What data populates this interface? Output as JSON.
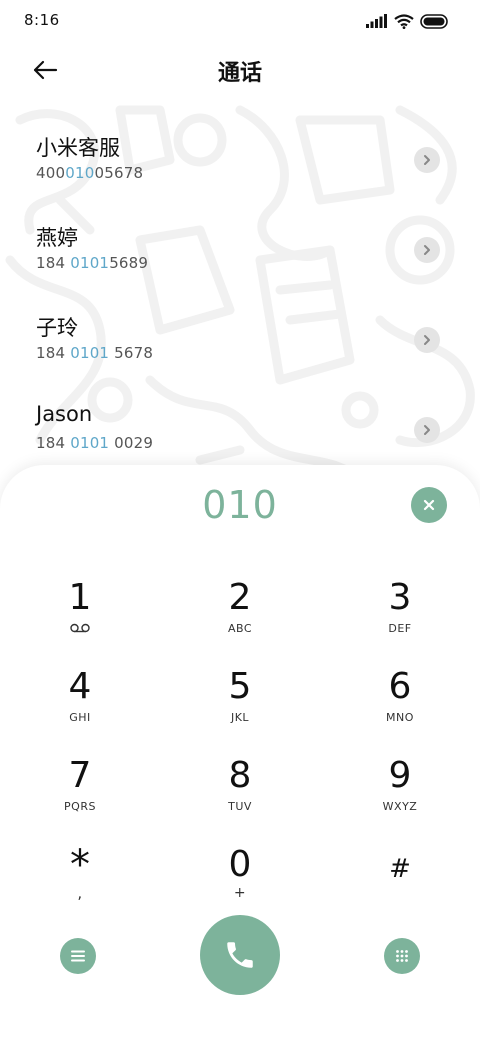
{
  "status_bar": {
    "time": "8:16",
    "icons": [
      "signal-icon",
      "wifi-icon",
      "battery-icon"
    ]
  },
  "header": {
    "title": "通话",
    "back_icon": "back-arrow-icon"
  },
  "results": [
    {
      "name": "小米客服",
      "number_pre": "400",
      "number_match": "010",
      "number_post": "05678"
    },
    {
      "name": "燕婷",
      "number_pre": "184 ",
      "number_match": "0101",
      "number_post": "5689"
    },
    {
      "name": "子玲",
      "number_pre": "184 ",
      "number_match": "0101",
      "number_post": " 5678"
    },
    {
      "name": "Jason",
      "number_pre": "184 ",
      "number_match": "0101",
      "number_post": " 0029"
    }
  ],
  "dialer": {
    "input_value": "010",
    "clear_icon": "clear-icon",
    "keys": [
      {
        "digit": "1",
        "letters": ""
      },
      {
        "digit": "2",
        "letters": "ABC"
      },
      {
        "digit": "3",
        "letters": "DEF"
      },
      {
        "digit": "4",
        "letters": "GHI"
      },
      {
        "digit": "5",
        "letters": "JKL"
      },
      {
        "digit": "6",
        "letters": "MNO"
      },
      {
        "digit": "7",
        "letters": "PQRS"
      },
      {
        "digit": "8",
        "letters": "TUV"
      },
      {
        "digit": "9",
        "letters": "WXYZ"
      },
      {
        "digit": "*",
        "letters": ","
      },
      {
        "digit": "0",
        "letters": "+"
      },
      {
        "digit": "#",
        "letters": ""
      }
    ],
    "actions": [
      "menu-icon",
      "phone-icon",
      "keypad-icon"
    ]
  },
  "colors": {
    "accent": "#7db39b",
    "match_highlight": "#5fa7c9"
  }
}
